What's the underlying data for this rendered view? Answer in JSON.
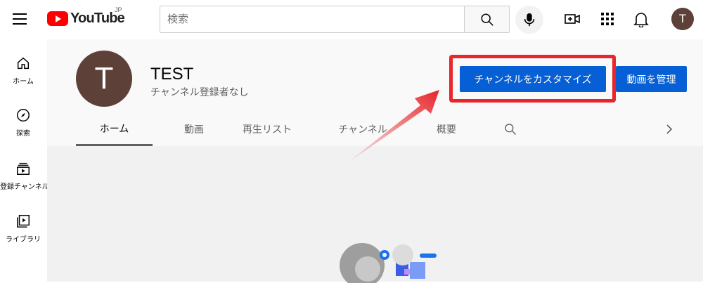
{
  "topbar": {
    "logo_text": "YouTube",
    "country_code": "JP",
    "search_placeholder": "検索",
    "avatar_letter": "T"
  },
  "sidebar": {
    "items": [
      {
        "label": "ホーム",
        "icon": "home-icon"
      },
      {
        "label": "探索",
        "icon": "compass-icon"
      },
      {
        "label": "登録チャンネル",
        "icon": "subscriptions-icon"
      },
      {
        "label": "ライブラリ",
        "icon": "library-icon"
      }
    ]
  },
  "channel": {
    "avatar_letter": "T",
    "name": "TEST",
    "subscribers": "チャンネル登録者なし",
    "customize_label": "チャンネルをカスタマイズ",
    "manage_label": "動画を管理"
  },
  "tabs": [
    {
      "label": "ホーム",
      "active": true
    },
    {
      "label": "動画"
    },
    {
      "label": "再生リスト"
    },
    {
      "label": "チャンネル"
    },
    {
      "label": "概要"
    }
  ],
  "colors": {
    "accent_blue": "#065fd4",
    "highlight_red": "#e8262c",
    "youtube_red": "#ff0000",
    "avatar_brown": "#5d4037"
  }
}
